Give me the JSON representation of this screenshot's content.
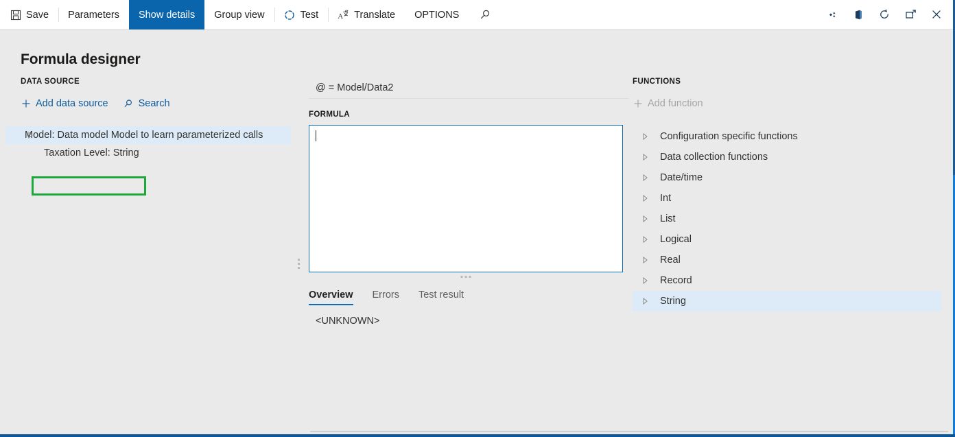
{
  "window": {
    "title": "Formula designer"
  },
  "commandbar": {
    "items": [
      {
        "label": "Save",
        "icon": "save-icon",
        "active": false
      },
      {
        "label": "Parameters",
        "icon": "",
        "active": false
      },
      {
        "label": "Show details",
        "icon": "",
        "active": true
      },
      {
        "label": "Group view",
        "icon": "",
        "active": false
      },
      {
        "label": "Test",
        "icon": "test-spinner-icon",
        "active": false
      },
      {
        "label": "Translate",
        "icon": "translate-icon",
        "active": false
      },
      {
        "label": "OPTIONS",
        "icon": "",
        "active": false
      },
      {
        "label": "",
        "icon": "search-icon",
        "active": false
      }
    ],
    "window_controls": [
      {
        "name": "diagnostics-icon"
      },
      {
        "name": "office-app-icon"
      },
      {
        "name": "refresh-icon"
      },
      {
        "name": "popout-icon"
      },
      {
        "name": "close-icon"
      }
    ]
  },
  "page": {
    "title": "Formula designer"
  },
  "data_source": {
    "heading": "DATA SOURCE",
    "add_label": "Add data source",
    "search_label": "Search",
    "tree": [
      {
        "label": "Model: Data model Model to learn parameterized calls",
        "level": 0,
        "selected": true,
        "expandable": true,
        "highlighted": false
      },
      {
        "label": "Taxation Level: String",
        "level": 1,
        "selected": false,
        "expandable": false,
        "highlighted": true
      }
    ],
    "highlight_color": "#1ca83c"
  },
  "formula_panel": {
    "context_path": "@ = Model/Data2",
    "heading": "FORMULA",
    "value": "",
    "placeholder": "",
    "tabs": [
      {
        "label": "Overview",
        "selected": true
      },
      {
        "label": "Errors",
        "selected": false
      },
      {
        "label": "Test result",
        "selected": false
      }
    ],
    "overview_text": "<UNKNOWN>"
  },
  "functions": {
    "heading": "FUNCTIONS",
    "add_label": "Add function",
    "add_disabled": true,
    "items": [
      {
        "label": "Configuration specific functions",
        "selected": false
      },
      {
        "label": "Data collection functions",
        "selected": false
      },
      {
        "label": "Date/time",
        "selected": false
      },
      {
        "label": "Int",
        "selected": false
      },
      {
        "label": "List",
        "selected": false
      },
      {
        "label": "Logical",
        "selected": false
      },
      {
        "label": "Real",
        "selected": false
      },
      {
        "label": "Record",
        "selected": false
      },
      {
        "label": "String",
        "selected": true
      }
    ]
  },
  "theme": {
    "accent": "#0b65ad",
    "link": "#0f5b9e",
    "selection": "#dcebf7",
    "border_blue": "#0f6cb4",
    "page_bg": "#eaeaea",
    "frame_blue": "#0f7ce0"
  }
}
